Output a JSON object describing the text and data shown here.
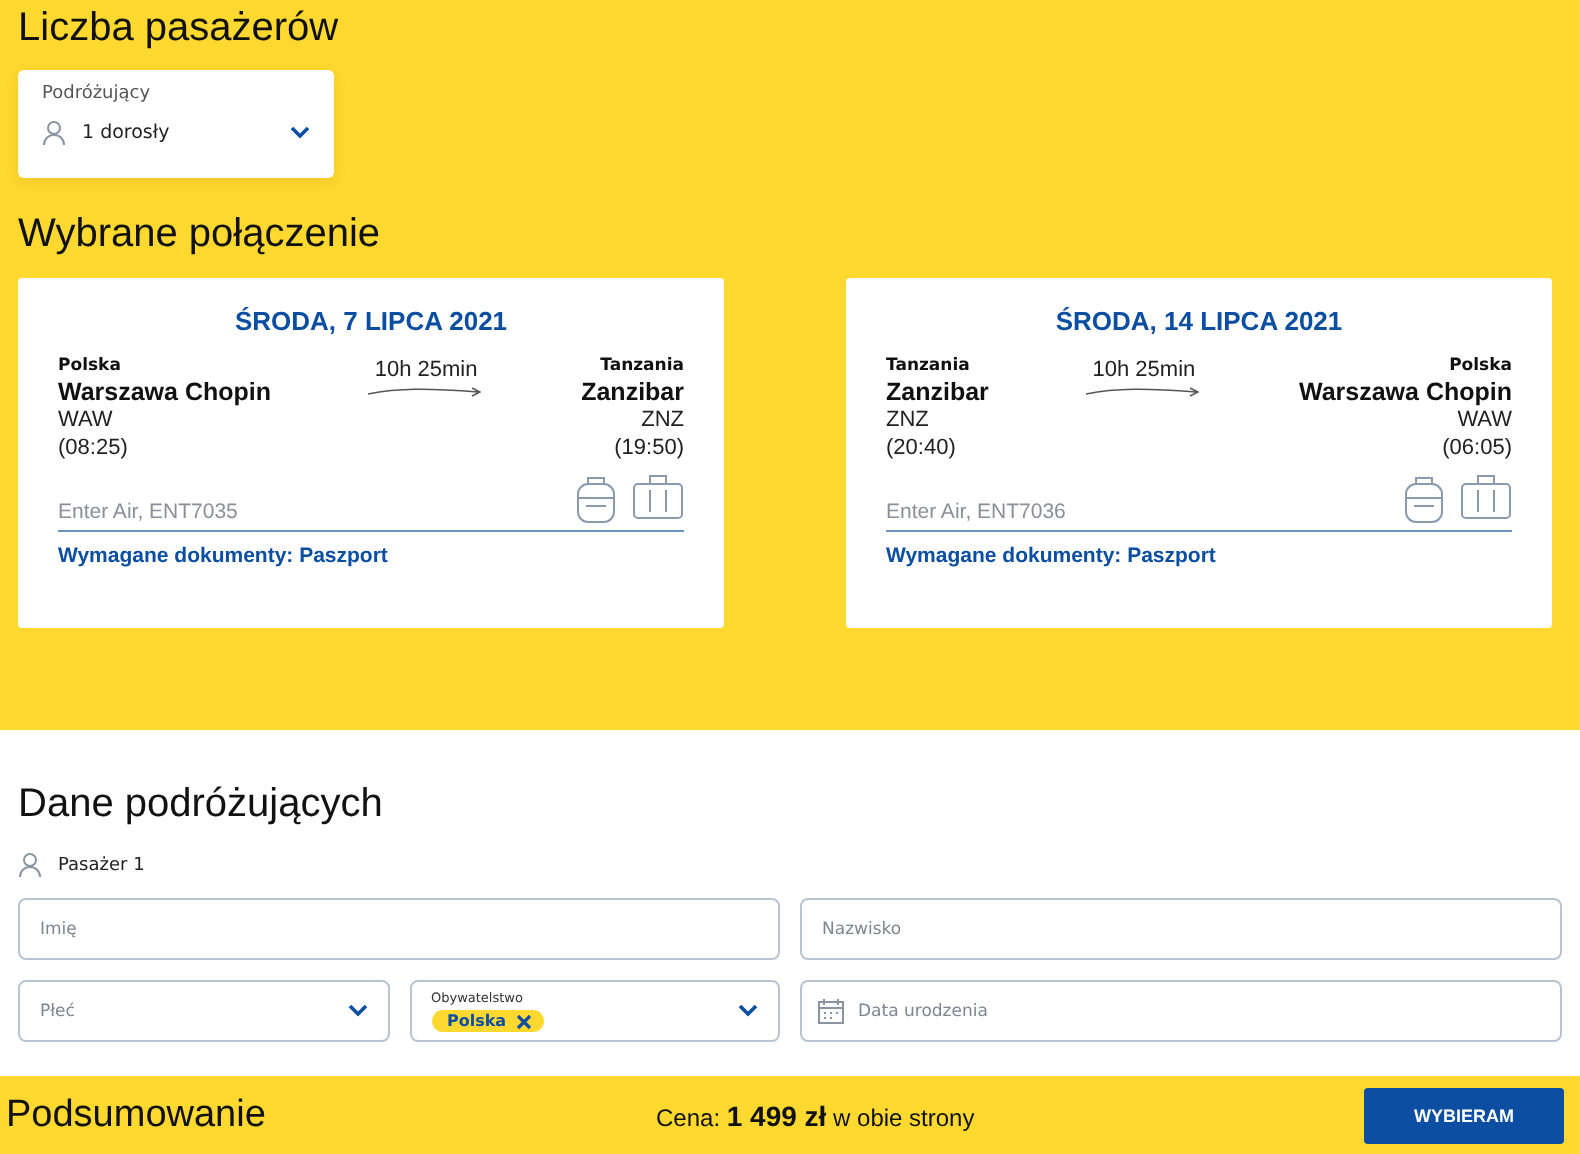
{
  "passengers_section": {
    "title": "Liczba pasażerów",
    "select": {
      "label": "Podróżujący",
      "value": "1 dorosły"
    }
  },
  "connection_section": {
    "title": "Wybrane połączenie",
    "flights": [
      {
        "date": "ŚRODA, 7 LIPCA 2021",
        "duration": "10h 25min",
        "from": {
          "country": "Polska",
          "city": "Warszawa Chopin",
          "code": "WAW",
          "time": "(08:25)"
        },
        "to": {
          "country": "Tanzania",
          "city": "Zanzibar",
          "code": "ZNZ",
          "time": "(19:50)"
        },
        "carrier": "Enter Air, ENT7035",
        "documents": "Wymagane dokumenty: Paszport"
      },
      {
        "date": "ŚRODA, 14 LIPCA 2021",
        "duration": "10h 25min",
        "from": {
          "country": "Tanzania",
          "city": "Zanzibar",
          "code": "ZNZ",
          "time": "(20:40)"
        },
        "to": {
          "country": "Polska",
          "city": "Warszawa Chopin",
          "code": "WAW",
          "time": "(06:05)"
        },
        "carrier": "Enter Air, ENT7036",
        "documents": "Wymagane dokumenty: Paszport"
      }
    ]
  },
  "travellers_section": {
    "title": "Dane podróżujących",
    "passenger": "Pasażer 1",
    "fields": [
      {
        "kind": "text",
        "placeholder": "Imię"
      },
      {
        "kind": "text",
        "placeholder": "Nazwisko"
      },
      {
        "kind": "select",
        "placeholder": "Płeć"
      },
      {
        "kind": "tags",
        "label": "Obywatelstwo",
        "tags": [
          "Polska"
        ]
      },
      {
        "kind": "date",
        "placeholder": "Data urodzenia"
      }
    ]
  },
  "summary_bar": {
    "title": "Podsumowanie",
    "price": "Cena: **1 499 zł** w obie strony",
    "button": "WYBIERAM"
  }
}
